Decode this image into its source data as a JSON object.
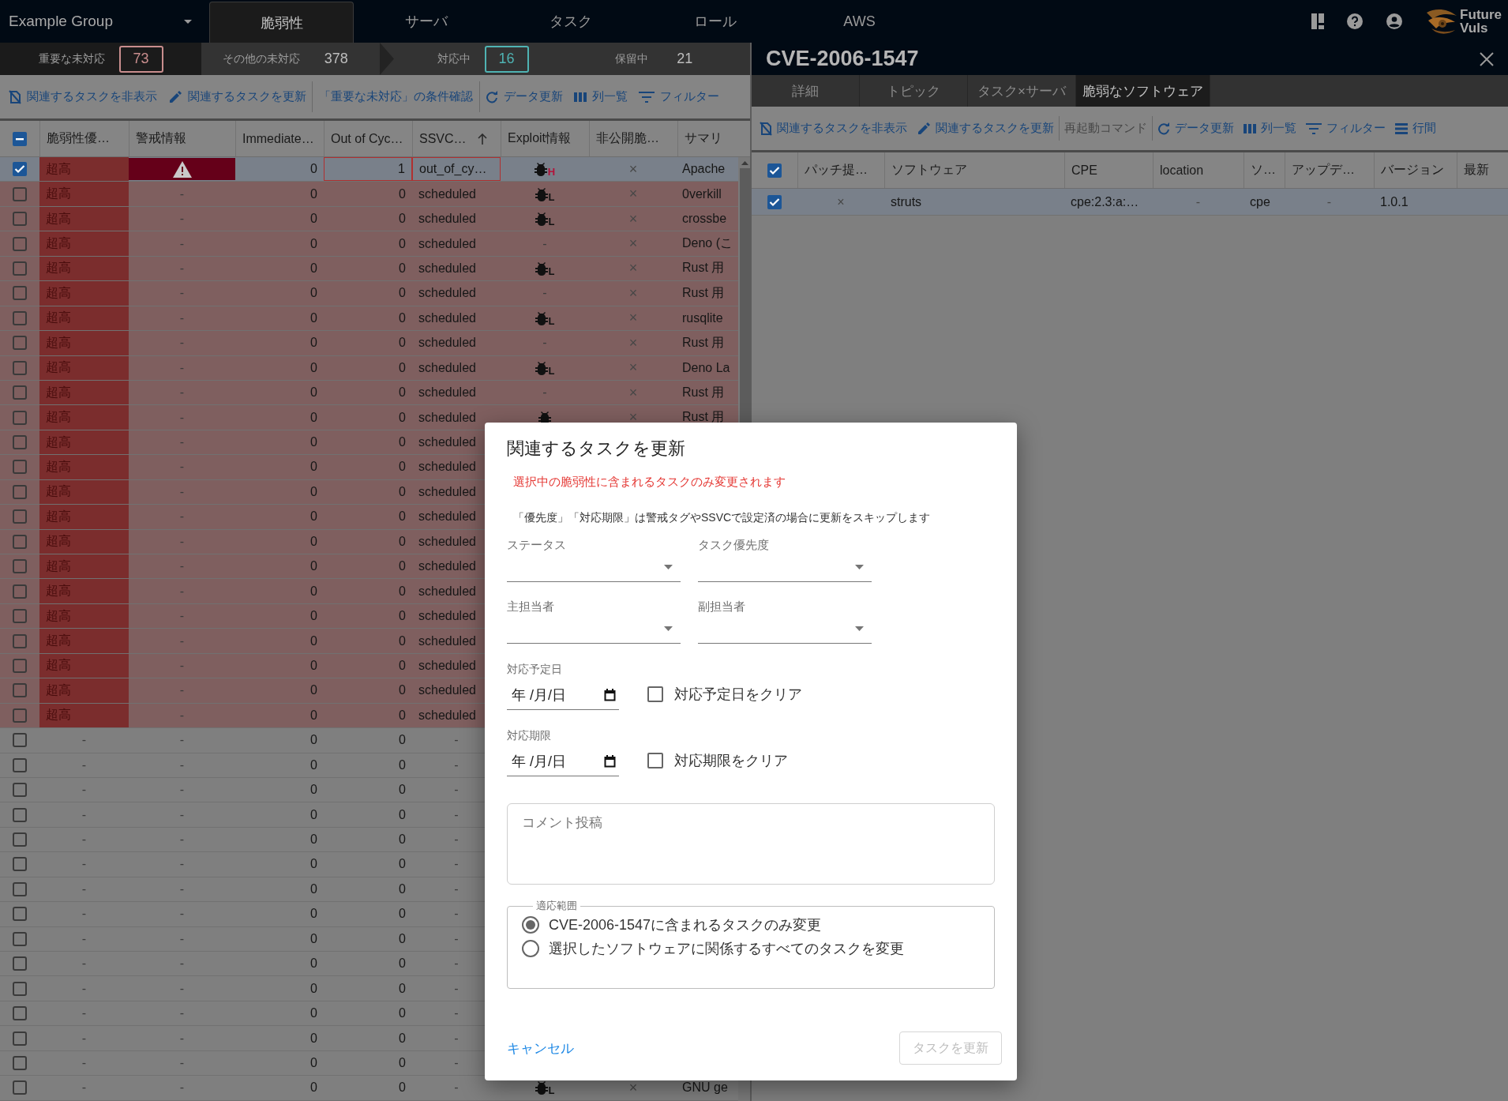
{
  "topbar": {
    "group": "Example Group",
    "tabs": [
      {
        "label": "脆弱性",
        "selected": true
      },
      {
        "label": "サーバ",
        "selected": false
      },
      {
        "label": "タスク",
        "selected": false
      },
      {
        "label": "ロール",
        "selected": false
      },
      {
        "label": "AWS",
        "selected": false
      }
    ],
    "logo": [
      "Future",
      "Vuls"
    ]
  },
  "status": [
    {
      "label": "重要な未対応",
      "count": "73",
      "selected": true,
      "color": "#c98e8e"
    },
    {
      "label": "その他の未対応",
      "count": "378",
      "selected": false
    },
    {
      "label": "対応中",
      "count": "16",
      "selected": false,
      "color": "#4fb3b3"
    },
    {
      "label": "保留中",
      "count": "21",
      "selected": false
    }
  ],
  "left_toolbar": [
    {
      "kind": "hide",
      "label": "関連するタスクを非表示",
      "disabled": false
    },
    {
      "kind": "edit",
      "label": "関連するタスクを更新",
      "disabled": false
    },
    {
      "kind": "text",
      "label": "「重要な未対応」の条件確認",
      "disabled": false
    },
    {
      "kind": "refresh",
      "label": "データ更新",
      "disabled": false
    },
    {
      "kind": "columns",
      "label": "列一覧",
      "disabled": false
    },
    {
      "kind": "filter",
      "label": "フィルター",
      "disabled": false
    }
  ],
  "table": {
    "select_all": {
      "indeterminate": true
    },
    "columns": [
      {
        "label": "脆弱性優…"
      },
      {
        "label": "警戒情報"
      },
      {
        "label": "Immediate…"
      },
      {
        "label": "Out of Cyc…"
      },
      {
        "label": "SSVC…",
        "sorted": true
      },
      {
        "label": "Exploit情報"
      },
      {
        "label": "非公開脆…"
      },
      {
        "label": "サマリ"
      }
    ],
    "rows": [
      {
        "checked": true,
        "kind": "critical",
        "priority": "超高",
        "alert_flag": true,
        "immediate": "0",
        "out_of_cycle": "1",
        "flagged": true,
        "ssvc": "out_of_cy…",
        "exploit": {
          "kind": "bug",
          "grade": "H"
        },
        "nonpublic": "×",
        "summary": "Apache"
      },
      {
        "checked": false,
        "kind": "critical",
        "priority": "超高",
        "alert_flag": false,
        "alert": "-",
        "immediate": "0",
        "out_of_cycle": "0",
        "flagged": false,
        "ssvc": "scheduled",
        "exploit": {
          "kind": "bug",
          "grade": "L"
        },
        "nonpublic": "×",
        "summary": "0verkill"
      },
      {
        "checked": false,
        "kind": "critical",
        "priority": "超高",
        "alert_flag": false,
        "alert": "-",
        "immediate": "0",
        "out_of_cycle": "0",
        "flagged": false,
        "ssvc": "scheduled",
        "exploit": {
          "kind": "bug",
          "grade": "L"
        },
        "nonpublic": "×",
        "summary": "crossbe"
      },
      {
        "checked": false,
        "kind": "critical",
        "priority": "超高",
        "alert_flag": false,
        "alert": "-",
        "immediate": "0",
        "out_of_cycle": "0",
        "flagged": false,
        "ssvc": "scheduled",
        "exploit": {
          "kind": "text",
          "text": "-"
        },
        "nonpublic": "×",
        "summary": "Deno (こ"
      },
      {
        "checked": false,
        "kind": "critical",
        "priority": "超高",
        "alert_flag": false,
        "alert": "-",
        "immediate": "0",
        "out_of_cycle": "0",
        "flagged": false,
        "ssvc": "scheduled",
        "exploit": {
          "kind": "bug",
          "grade": "L"
        },
        "nonpublic": "×",
        "summary": "Rust 用"
      },
      {
        "checked": false,
        "kind": "critical",
        "priority": "超高",
        "alert_flag": false,
        "alert": "-",
        "immediate": "0",
        "out_of_cycle": "0",
        "flagged": false,
        "ssvc": "scheduled",
        "exploit": {
          "kind": "text",
          "text": "-"
        },
        "nonpublic": "×",
        "summary": "Rust 用"
      },
      {
        "checked": false,
        "kind": "critical",
        "priority": "超高",
        "alert_flag": false,
        "alert": "-",
        "immediate": "0",
        "out_of_cycle": "0",
        "flagged": false,
        "ssvc": "scheduled",
        "exploit": {
          "kind": "bug",
          "grade": "L"
        },
        "nonpublic": "×",
        "summary": "rusqlite"
      },
      {
        "checked": false,
        "kind": "critical",
        "priority": "超高",
        "alert_flag": false,
        "alert": "-",
        "immediate": "0",
        "out_of_cycle": "0",
        "flagged": false,
        "ssvc": "scheduled",
        "exploit": {
          "kind": "text",
          "text": "-"
        },
        "nonpublic": "×",
        "summary": "Rust 用"
      },
      {
        "checked": false,
        "kind": "critical",
        "priority": "超高",
        "alert_flag": false,
        "alert": "-",
        "immediate": "0",
        "out_of_cycle": "0",
        "flagged": false,
        "ssvc": "scheduled",
        "exploit": {
          "kind": "bug",
          "grade": "L"
        },
        "nonpublic": "×",
        "summary": "Deno La"
      },
      {
        "checked": false,
        "kind": "critical",
        "priority": "超高",
        "alert_flag": false,
        "alert": "-",
        "immediate": "0",
        "out_of_cycle": "0",
        "flagged": false,
        "ssvc": "scheduled",
        "exploit": {
          "kind": "text",
          "text": "-"
        },
        "nonpublic": "×",
        "summary": "Rust 用"
      },
      {
        "checked": false,
        "kind": "critical",
        "priority": "超高",
        "alert_flag": false,
        "alert": "-",
        "immediate": "0",
        "out_of_cycle": "0",
        "flagged": false,
        "ssvc": "scheduled",
        "exploit": {
          "kind": "bug"
        },
        "nonpublic": "×",
        "summary": "Rust 用"
      },
      {
        "checked": false,
        "kind": "critical",
        "priority": "超高",
        "alert_flag": false,
        "alert": "-",
        "immediate": "0",
        "out_of_cycle": "0",
        "flagged": false,
        "ssvc": "scheduled"
      },
      {
        "checked": false,
        "kind": "critical",
        "priority": "超高",
        "alert_flag": false,
        "alert": "-",
        "immediate": "0",
        "out_of_cycle": "0",
        "flagged": false,
        "ssvc": "scheduled"
      },
      {
        "checked": false,
        "kind": "critical",
        "priority": "超高",
        "alert_flag": false,
        "alert": "-",
        "immediate": "0",
        "out_of_cycle": "0",
        "flagged": false,
        "ssvc": "scheduled"
      },
      {
        "checked": false,
        "kind": "critical",
        "priority": "超高",
        "alert_flag": false,
        "alert": "-",
        "immediate": "0",
        "out_of_cycle": "0",
        "flagged": false,
        "ssvc": "scheduled"
      },
      {
        "checked": false,
        "kind": "critical",
        "priority": "超高",
        "alert_flag": false,
        "alert": "-",
        "immediate": "0",
        "out_of_cycle": "0",
        "flagged": false,
        "ssvc": "scheduled"
      },
      {
        "checked": false,
        "kind": "critical",
        "priority": "超高",
        "alert_flag": false,
        "alert": "-",
        "immediate": "0",
        "out_of_cycle": "0",
        "flagged": false,
        "ssvc": "scheduled"
      },
      {
        "checked": false,
        "kind": "critical",
        "priority": "超高",
        "alert_flag": false,
        "alert": "-",
        "immediate": "0",
        "out_of_cycle": "0",
        "flagged": false,
        "ssvc": "scheduled"
      },
      {
        "checked": false,
        "kind": "critical",
        "priority": "超高",
        "alert_flag": false,
        "alert": "-",
        "immediate": "0",
        "out_of_cycle": "0",
        "flagged": false,
        "ssvc": "scheduled"
      },
      {
        "checked": false,
        "kind": "critical",
        "priority": "超高",
        "alert_flag": false,
        "alert": "-",
        "immediate": "0",
        "out_of_cycle": "0",
        "flagged": false,
        "ssvc": "scheduled"
      },
      {
        "checked": false,
        "kind": "critical",
        "priority": "超高",
        "alert_flag": false,
        "alert": "-",
        "immediate": "0",
        "out_of_cycle": "0",
        "flagged": false,
        "ssvc": "scheduled"
      },
      {
        "checked": false,
        "kind": "critical",
        "priority": "超高",
        "alert_flag": false,
        "alert": "-",
        "immediate": "0",
        "out_of_cycle": "0",
        "flagged": false,
        "ssvc": "scheduled"
      },
      {
        "checked": false,
        "kind": "critical",
        "priority": "超高",
        "alert_flag": false,
        "alert": "-",
        "immediate": "0",
        "out_of_cycle": "0",
        "flagged": false,
        "ssvc": "scheduled"
      },
      {
        "checked": false,
        "kind": "plain",
        "priority": "-",
        "alert_flag": false,
        "alert": "-",
        "immediate": "0",
        "out_of_cycle": "0",
        "flagged": false,
        "ssvc": "-"
      },
      {
        "checked": false,
        "kind": "plain",
        "priority": "-",
        "alert_flag": false,
        "alert": "-",
        "immediate": "0",
        "out_of_cycle": "0",
        "flagged": false,
        "ssvc": "-"
      },
      {
        "checked": false,
        "kind": "plain",
        "priority": "-",
        "alert_flag": false,
        "alert": "-",
        "immediate": "0",
        "out_of_cycle": "0",
        "flagged": false,
        "ssvc": "-"
      },
      {
        "checked": false,
        "kind": "plain",
        "priority": "-",
        "alert_flag": false,
        "alert": "-",
        "immediate": "0",
        "out_of_cycle": "0",
        "flagged": false,
        "ssvc": "-"
      },
      {
        "checked": false,
        "kind": "plain",
        "priority": "-",
        "alert_flag": false,
        "alert": "-",
        "immediate": "0",
        "out_of_cycle": "0",
        "flagged": false,
        "ssvc": "-"
      },
      {
        "checked": false,
        "kind": "plain",
        "priority": "-",
        "alert_flag": false,
        "alert": "-",
        "immediate": "0",
        "out_of_cycle": "0",
        "flagged": false,
        "ssvc": "-"
      },
      {
        "checked": false,
        "kind": "plain",
        "priority": "-",
        "alert_flag": false,
        "alert": "-",
        "immediate": "0",
        "out_of_cycle": "0",
        "flagged": false,
        "ssvc": "-"
      },
      {
        "checked": false,
        "kind": "plain",
        "priority": "-",
        "alert_flag": false,
        "alert": "-",
        "immediate": "0",
        "out_of_cycle": "0",
        "flagged": false,
        "ssvc": "-"
      },
      {
        "checked": false,
        "kind": "plain",
        "priority": "-",
        "alert_flag": false,
        "alert": "-",
        "immediate": "0",
        "out_of_cycle": "0",
        "flagged": false,
        "ssvc": "-"
      },
      {
        "checked": false,
        "kind": "plain",
        "priority": "-",
        "alert_flag": false,
        "alert": "-",
        "immediate": "0",
        "out_of_cycle": "0",
        "flagged": false,
        "ssvc": "-"
      },
      {
        "checked": false,
        "kind": "plain",
        "priority": "-",
        "alert_flag": false,
        "alert": "-",
        "immediate": "0",
        "out_of_cycle": "0",
        "flagged": false,
        "ssvc": "-"
      },
      {
        "checked": false,
        "kind": "plain",
        "priority": "-",
        "alert_flag": false,
        "alert": "-",
        "immediate": "0",
        "out_of_cycle": "0",
        "flagged": false,
        "ssvc": "-"
      },
      {
        "checked": false,
        "kind": "plain",
        "priority": "-",
        "alert_flag": false,
        "alert": "-",
        "immediate": "0",
        "out_of_cycle": "0",
        "flagged": false,
        "ssvc": "-"
      },
      {
        "checked": false,
        "kind": "plain",
        "priority": "-",
        "alert_flag": false,
        "alert": "-",
        "immediate": "0",
        "out_of_cycle": "0",
        "flagged": false,
        "ssvc": "-"
      },
      {
        "checked": false,
        "kind": "plain",
        "priority": "-",
        "alert_flag": false,
        "alert": "-",
        "immediate": "0",
        "out_of_cycle": "0",
        "flagged": false,
        "ssvc": "-",
        "exploit": {
          "kind": "bug",
          "grade": "L"
        },
        "nonpublic": "×",
        "summary": "GNU ge"
      }
    ]
  },
  "detail": {
    "title": "CVE-2006-1547",
    "tabs": [
      {
        "label": "詳細",
        "selected": false
      },
      {
        "label": "トピック",
        "selected": false
      },
      {
        "label": "タスク×サーバ",
        "selected": false
      },
      {
        "label": "脆弱なソフトウェア",
        "selected": true
      }
    ],
    "toolbar": [
      {
        "kind": "hide",
        "label": "関連するタスクを非表示",
        "disabled": false
      },
      {
        "kind": "edit",
        "label": "関連するタスクを更新",
        "disabled": false
      },
      {
        "kind": "text",
        "label": "再起動コマンド",
        "disabled": true
      },
      {
        "kind": "refresh",
        "label": "データ更新",
        "disabled": false
      },
      {
        "kind": "columns",
        "label": "列一覧",
        "disabled": false
      },
      {
        "kind": "filter",
        "label": "フィルター",
        "disabled": false
      },
      {
        "kind": "density",
        "label": "行間",
        "disabled": false
      }
    ],
    "select_all": {
      "checked": true
    },
    "columns": [
      "パッチ提…",
      "ソフトウェア",
      "CPE",
      "location",
      "ソ…",
      "アップデ…",
      "バージョン",
      "最新"
    ],
    "rows": [
      {
        "checked": true,
        "cells": [
          "×",
          "struts",
          "cpe:2.3:a:…",
          "-",
          "cpe",
          "-",
          "1.0.1"
        ]
      }
    ]
  },
  "dialog": {
    "title": "関連するタスクを更新",
    "warning": "選択中の脆弱性に含まれるタスクのみ変更されます",
    "note": "「優先度」「対応期限」は警戒タグやSSVCで設定済の場合に更新をスキップします",
    "selects": [
      {
        "label": "ステータス"
      },
      {
        "label": "タスク優先度"
      },
      {
        "label": "主担当者"
      },
      {
        "label": "副担当者"
      }
    ],
    "dates": [
      {
        "label": "対応予定日",
        "placeholder": "年 /月/日",
        "clear_label": "対応予定日をクリア",
        "checked": false
      },
      {
        "label": "対応期限",
        "placeholder": "年 /月/日",
        "clear_label": "対応期限をクリア",
        "checked": false
      }
    ],
    "comment": {
      "placeholder": "コメント投稿"
    },
    "scope": {
      "legend": "適応範囲",
      "options": [
        {
          "label": "CVE-2006-1547に含まれるタスクのみ変更",
          "selected": true
        },
        {
          "label": "選択したソフトウェアに関係するすべてのタスクを変更",
          "selected": false
        }
      ]
    },
    "cancel": "キャンセル",
    "submit": {
      "label": "タスクを更新",
      "disabled": true
    }
  }
}
